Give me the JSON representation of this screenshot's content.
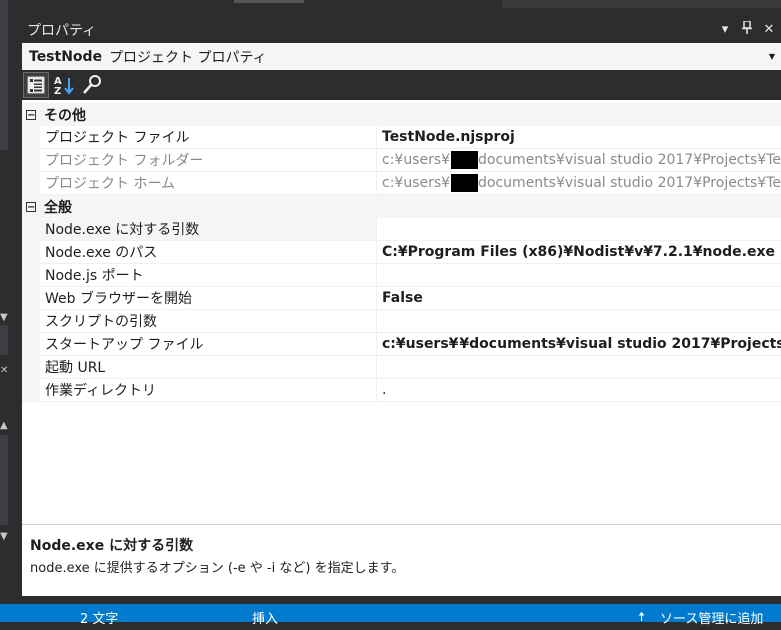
{
  "panel": {
    "title": "プロパティ",
    "controls": {
      "dropdown": "▾",
      "pin": "⊥",
      "close": "✕"
    }
  },
  "object_selector": {
    "name": "TestNode",
    "type": "プロジェクト プロパティ"
  },
  "toolbar": {
    "icons": [
      "categorized-icon",
      "alphabetical-icon",
      "property-pages-icon"
    ]
  },
  "categories": [
    {
      "label": "その他",
      "toggle": "−",
      "rows": [
        {
          "name": "プロジェクト ファイル",
          "value": "TestNode.njsproj",
          "bold": true,
          "readonly": false
        },
        {
          "name": "プロジェクト フォルダー",
          "value_pre": "c:¥users¥",
          "value_post": "documents¥visual studio 2017¥Projects¥Te",
          "readonly": true
        },
        {
          "name": "プロジェクト ホーム",
          "value_pre": "c:¥users¥",
          "value_post": "documents¥visual studio 2017¥Projects¥Te",
          "readonly": true
        }
      ]
    },
    {
      "label": "全般",
      "toggle": "−",
      "rows": [
        {
          "name": "Node.exe に対する引数",
          "value": ""
        },
        {
          "name": "Node.exe のパス",
          "value": "C:¥Program Files (x86)¥Nodist¥v¥7.2.1¥node.exe",
          "bold": true
        },
        {
          "name": "Node.js ポート",
          "value": ""
        },
        {
          "name": "Web ブラウザーを開始",
          "value": "False",
          "bold": true
        },
        {
          "name": "スクリプトの引数",
          "value": ""
        },
        {
          "name": "スタートアップ ファイル",
          "value_pre": "c:¥users¥",
          "value_post": "¥documents¥visual studio 2017¥Projects¥T",
          "bold": true
        },
        {
          "name": "起動 URL",
          "value": ""
        },
        {
          "name": "作業ディレクトリ",
          "value": "."
        }
      ]
    }
  ],
  "description": {
    "title": "Node.exe に対する引数",
    "text": "node.exe に提供するオプション (-e や -i など) を指定します。"
  },
  "statusbar": {
    "chars": "2 文字",
    "mode": "挿入",
    "source_control": "ソース管理に追加"
  }
}
